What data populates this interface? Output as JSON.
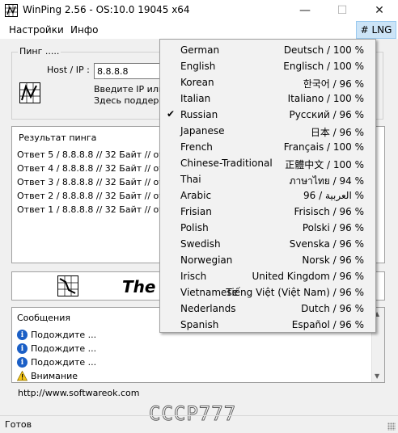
{
  "window": {
    "title": "WinPing 2.56 - OS:10.0 19045 x64",
    "minimize": "—",
    "maximize": "☐",
    "close": "✕"
  },
  "menu": {
    "settings": "Настройки",
    "info": "Инфо",
    "lng": "# LNG"
  },
  "ping": {
    "group_label": "Пинг .....",
    "host_label": "Host / IP :",
    "host_value": "8.8.8.8",
    "hint_line1": "Введите IP или з",
    "hint_line2": "Здесь поддерж"
  },
  "results": {
    "title": "Результат пинга",
    "rows": [
      "Ответ  5 / 8.8.8.8  // 32 Байт // отв",
      "Ответ  4 / 8.8.8.8  // 32 Байт // отв",
      "Ответ  3 / 8.8.8.8  // 32 Байт // отв",
      "Ответ  2 / 8.8.8.8  // 32 Байт // отв",
      "Ответ  1 / 8.8.8.8  // 32 Байт // отв"
    ]
  },
  "banner": {
    "text": "The"
  },
  "messages": {
    "title": "Сообщения",
    "rows": [
      {
        "icon": "info-icon",
        "text": "Подождите ..."
      },
      {
        "icon": "info-icon",
        "text": "Подождите ..."
      },
      {
        "icon": "info-icon",
        "text": "Подождите ..."
      },
      {
        "icon": "warning-icon",
        "text": "Внимание"
      }
    ]
  },
  "url": "http://www.softwareok.com",
  "watermark": "CCCP777",
  "status": "Готов",
  "languages": {
    "selected": "Russian",
    "items": [
      {
        "name": "German",
        "native": "Deutsch / 100 %"
      },
      {
        "name": "English",
        "native": "Englisch / 100 %"
      },
      {
        "name": "Korean",
        "native": "한국어 / 96 %"
      },
      {
        "name": "Italian",
        "native": "Italiano / 100 %"
      },
      {
        "name": "Russian",
        "native": "Русский / 96 %"
      },
      {
        "name": "Japanese",
        "native": "日本 / 96 %"
      },
      {
        "name": "French",
        "native": "Français / 100 %"
      },
      {
        "name": "Chinese-Traditional",
        "native": "正體中文 / 100 %"
      },
      {
        "name": "Thai",
        "native": "ภาษาไทย / 94 %"
      },
      {
        "name": "Arabic",
        "native": "96 / العربية %"
      },
      {
        "name": "Frisian",
        "native": "Frisisch / 96 %"
      },
      {
        "name": "Polish",
        "native": "Polski / 96 %"
      },
      {
        "name": "Swedish",
        "native": "Svenska / 96 %"
      },
      {
        "name": "Norwegian",
        "native": "Norsk / 96 %"
      },
      {
        "name": "Irisch",
        "native": "United Kingdom / 96 %"
      },
      {
        "name": "Vietnamese",
        "native": "Tiếng Việt (Việt Nam) / 96 %"
      },
      {
        "name": "Nederlands",
        "native": "Dutch / 96 %"
      },
      {
        "name": "Spanish",
        "native": "Español / 96 %"
      }
    ]
  },
  "colors": {
    "lng_button_bg": "#cce4f7",
    "info_icon": "#1b5fc6",
    "warning_icon": "#f5c518"
  }
}
